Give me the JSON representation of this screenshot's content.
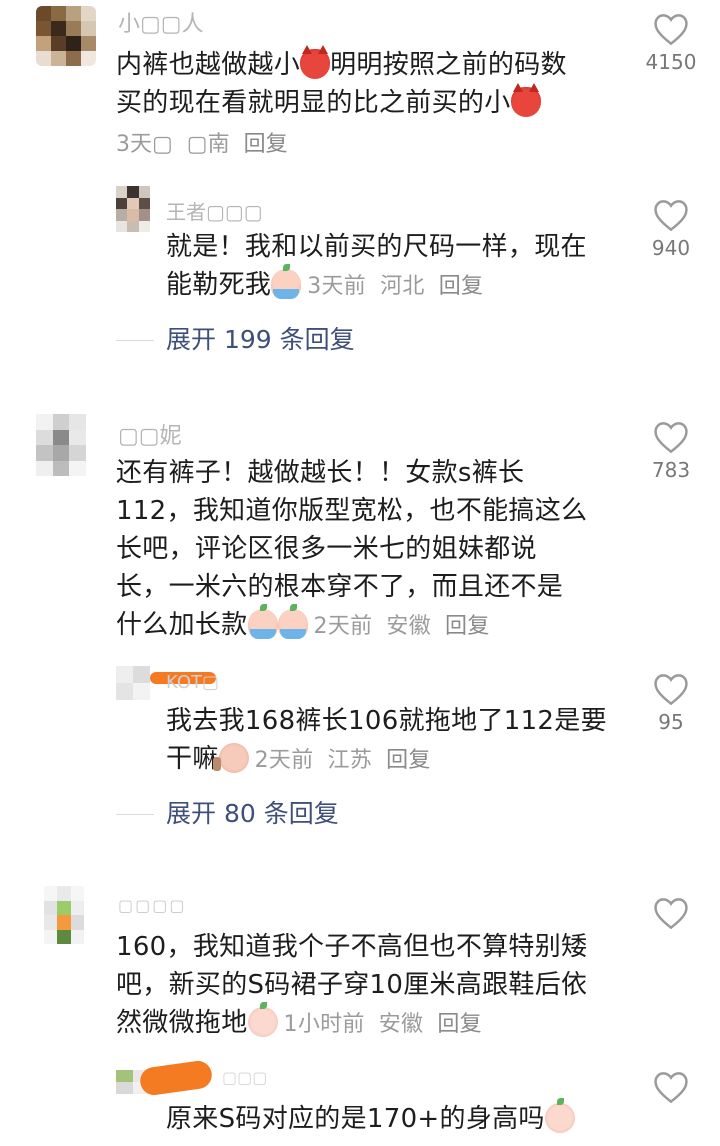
{
  "comments": [
    {
      "author": "小▢▢人",
      "text_lines": [
        "内裤也越做越小",
        "明明按照之前的码数",
        "买的现在看就明显的比之前买的小"
      ],
      "time": "3天▢",
      "location": "▢南",
      "reply": "回复",
      "likes": "4150",
      "replies": [
        {
          "author": "王者▢▢▢",
          "text_lines": [
            "就是！我和以前买的尺码一样，现在",
            "能勒死我"
          ],
          "time": "3天前",
          "location": "河北",
          "reply": "回复",
          "likes": "940"
        }
      ],
      "expand": "展开 199 条回复"
    },
    {
      "author": "▢▢妮",
      "text_lines": [
        "还有裤子！越做越长！！女款s裤长",
        "112，我知道你版型宽松，也不能搞这么",
        "长吧，评论区很多一米七的姐妹都说",
        "长，一米六的根本穿不了，而且还不是",
        "什么加长款"
      ],
      "time": "2天前",
      "location": "安徽",
      "reply": "回复",
      "likes": "783",
      "replies": [
        {
          "author": "KOT▢",
          "text_lines": [
            "我去我168裤长106就拖地了112是要",
            "干嘛"
          ],
          "time": "2天前",
          "location": "江苏",
          "reply": "回复",
          "likes": "95"
        }
      ],
      "expand": "展开 80 条回复"
    },
    {
      "author": "▢▢▢▢",
      "text_lines": [
        "160，我知道我个子不高但也不算特别矮",
        "吧，新买的S码裙子穿10厘米高跟鞋后依",
        "然微微拖地"
      ],
      "time": "1小时前",
      "location": "安徽",
      "reply": "回复",
      "likes": "",
      "replies": [
        {
          "author": "▢▢▢",
          "text_lines": [
            "原来S码对应的是170+的身高吗"
          ],
          "likes": ""
        }
      ]
    }
  ],
  "icons": {
    "heart": "heart-outline-icon",
    "devil_emoji": "devil-emoji-icon",
    "cry_emoji": "crying-emoji-icon",
    "peach_emoji": "peach-emoji-icon",
    "thinking_emoji": "thinking-emoji-icon"
  },
  "colors": {
    "expand_text": "#3e4f7a",
    "meta_text": "#9b9b9b",
    "redaction": "#f47b22"
  }
}
